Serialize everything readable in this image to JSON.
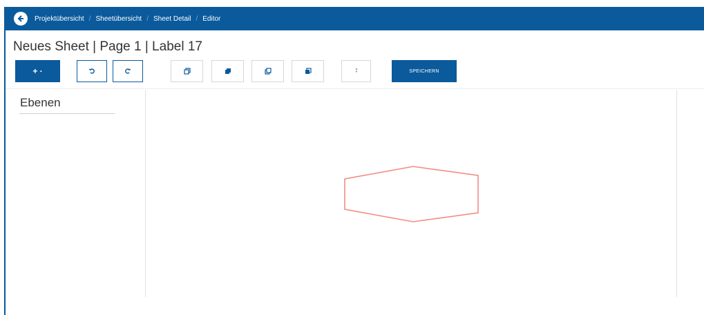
{
  "breadcrumb": {
    "items": [
      "Projektübersicht",
      "Sheetübersicht",
      "Sheet Detail",
      "Editor"
    ]
  },
  "page_title": "Neues Sheet | Page 1 | Label 17",
  "toolbar": {
    "add_label": "+ ·",
    "save_label": "SPEICHERN"
  },
  "layers_panel": {
    "title": "Ebenen"
  },
  "colors": {
    "brand": "#0a5a9c",
    "shape_stroke": "#f28b82"
  }
}
